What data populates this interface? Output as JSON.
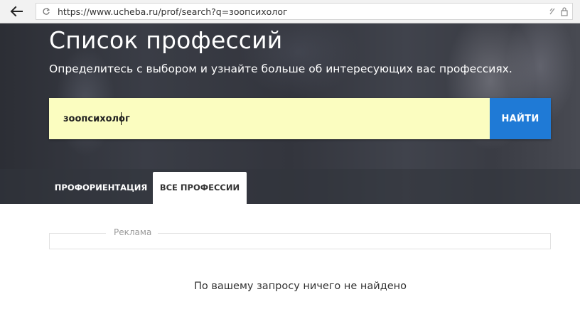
{
  "browser": {
    "url": "https://www.ucheba.ru/prof/search?q=зоопсихолог",
    "back_icon": "arrow-left-icon",
    "reload_icon": "reload-icon",
    "bookmark_icon": "star-icon",
    "security_icon": "lock-icon"
  },
  "hero": {
    "title": "Список профессий",
    "subtitle": "Определитесь с выбором и узнайте больше об интересующих вас профессиях."
  },
  "search": {
    "value": "зоопсихолог",
    "button_label": "НАЙТИ",
    "input_bg": "#fbfdc0",
    "button_color": "#1f7ad6"
  },
  "tabs": [
    {
      "label": "ПРОФОРИЕНТАЦИЯ",
      "active": false
    },
    {
      "label": "ВСЕ ПРОФЕССИИ",
      "active": true
    }
  ],
  "ad": {
    "label": "Реклама"
  },
  "results": {
    "empty_message": "По вашему запросу ничего не найдено"
  }
}
